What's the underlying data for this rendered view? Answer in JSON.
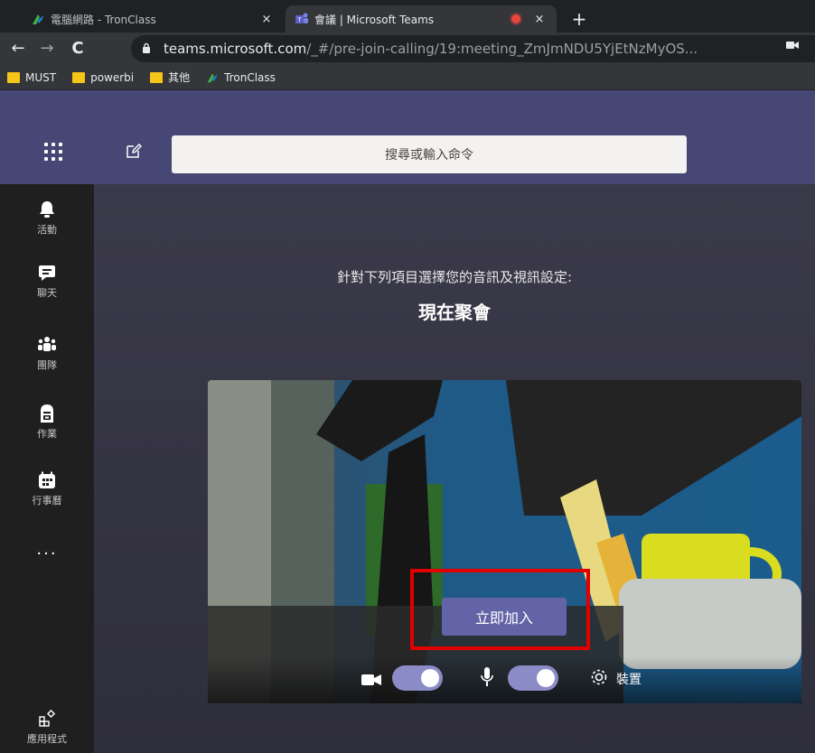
{
  "browser": {
    "tabs": [
      {
        "title": "電腦網路 - TronClass",
        "favicon": "tronclass-icon",
        "active": false
      },
      {
        "title": "會議 | Microsoft Teams",
        "favicon": "teams-icon",
        "active": true,
        "recording": true
      }
    ],
    "new_tab_icon": "+",
    "close_icon": "×",
    "url": {
      "host": "teams.microsoft.com",
      "path": "/_#/pre-join-calling/19:meeting_ZmJmNDU5YjEtNzMyOS..."
    },
    "bookmarks": [
      {
        "label": "MUST",
        "icon": "folder-icon"
      },
      {
        "label": "powerbi",
        "icon": "folder-icon"
      },
      {
        "label": "其他",
        "icon": "folder-icon"
      },
      {
        "label": "TronClass",
        "icon": "tronclass-icon"
      }
    ]
  },
  "teams": {
    "search_placeholder": "搜尋或輸入命令",
    "rail": [
      {
        "label": "活動",
        "icon": "bell-icon"
      },
      {
        "label": "聊天",
        "icon": "chat-icon"
      },
      {
        "label": "團隊",
        "icon": "teams-icon"
      },
      {
        "label": "作業",
        "icon": "assignments-icon"
      },
      {
        "label": "行事曆",
        "icon": "calendar-icon"
      },
      {
        "label": "...",
        "icon": "more-icon"
      },
      {
        "label": "應用程式",
        "icon": "apps-icon"
      }
    ],
    "prejoin": {
      "prompt": "針對下列項目選擇您的音訊及視訊設定:",
      "meeting_title": "現在聚會",
      "join_button": "立即加入",
      "camera_on": true,
      "mic_on": true,
      "devices_label": "裝置"
    }
  },
  "colors": {
    "teams_purple": "#464775",
    "accent": "#6264a7",
    "highlight_red": "#e00000"
  }
}
